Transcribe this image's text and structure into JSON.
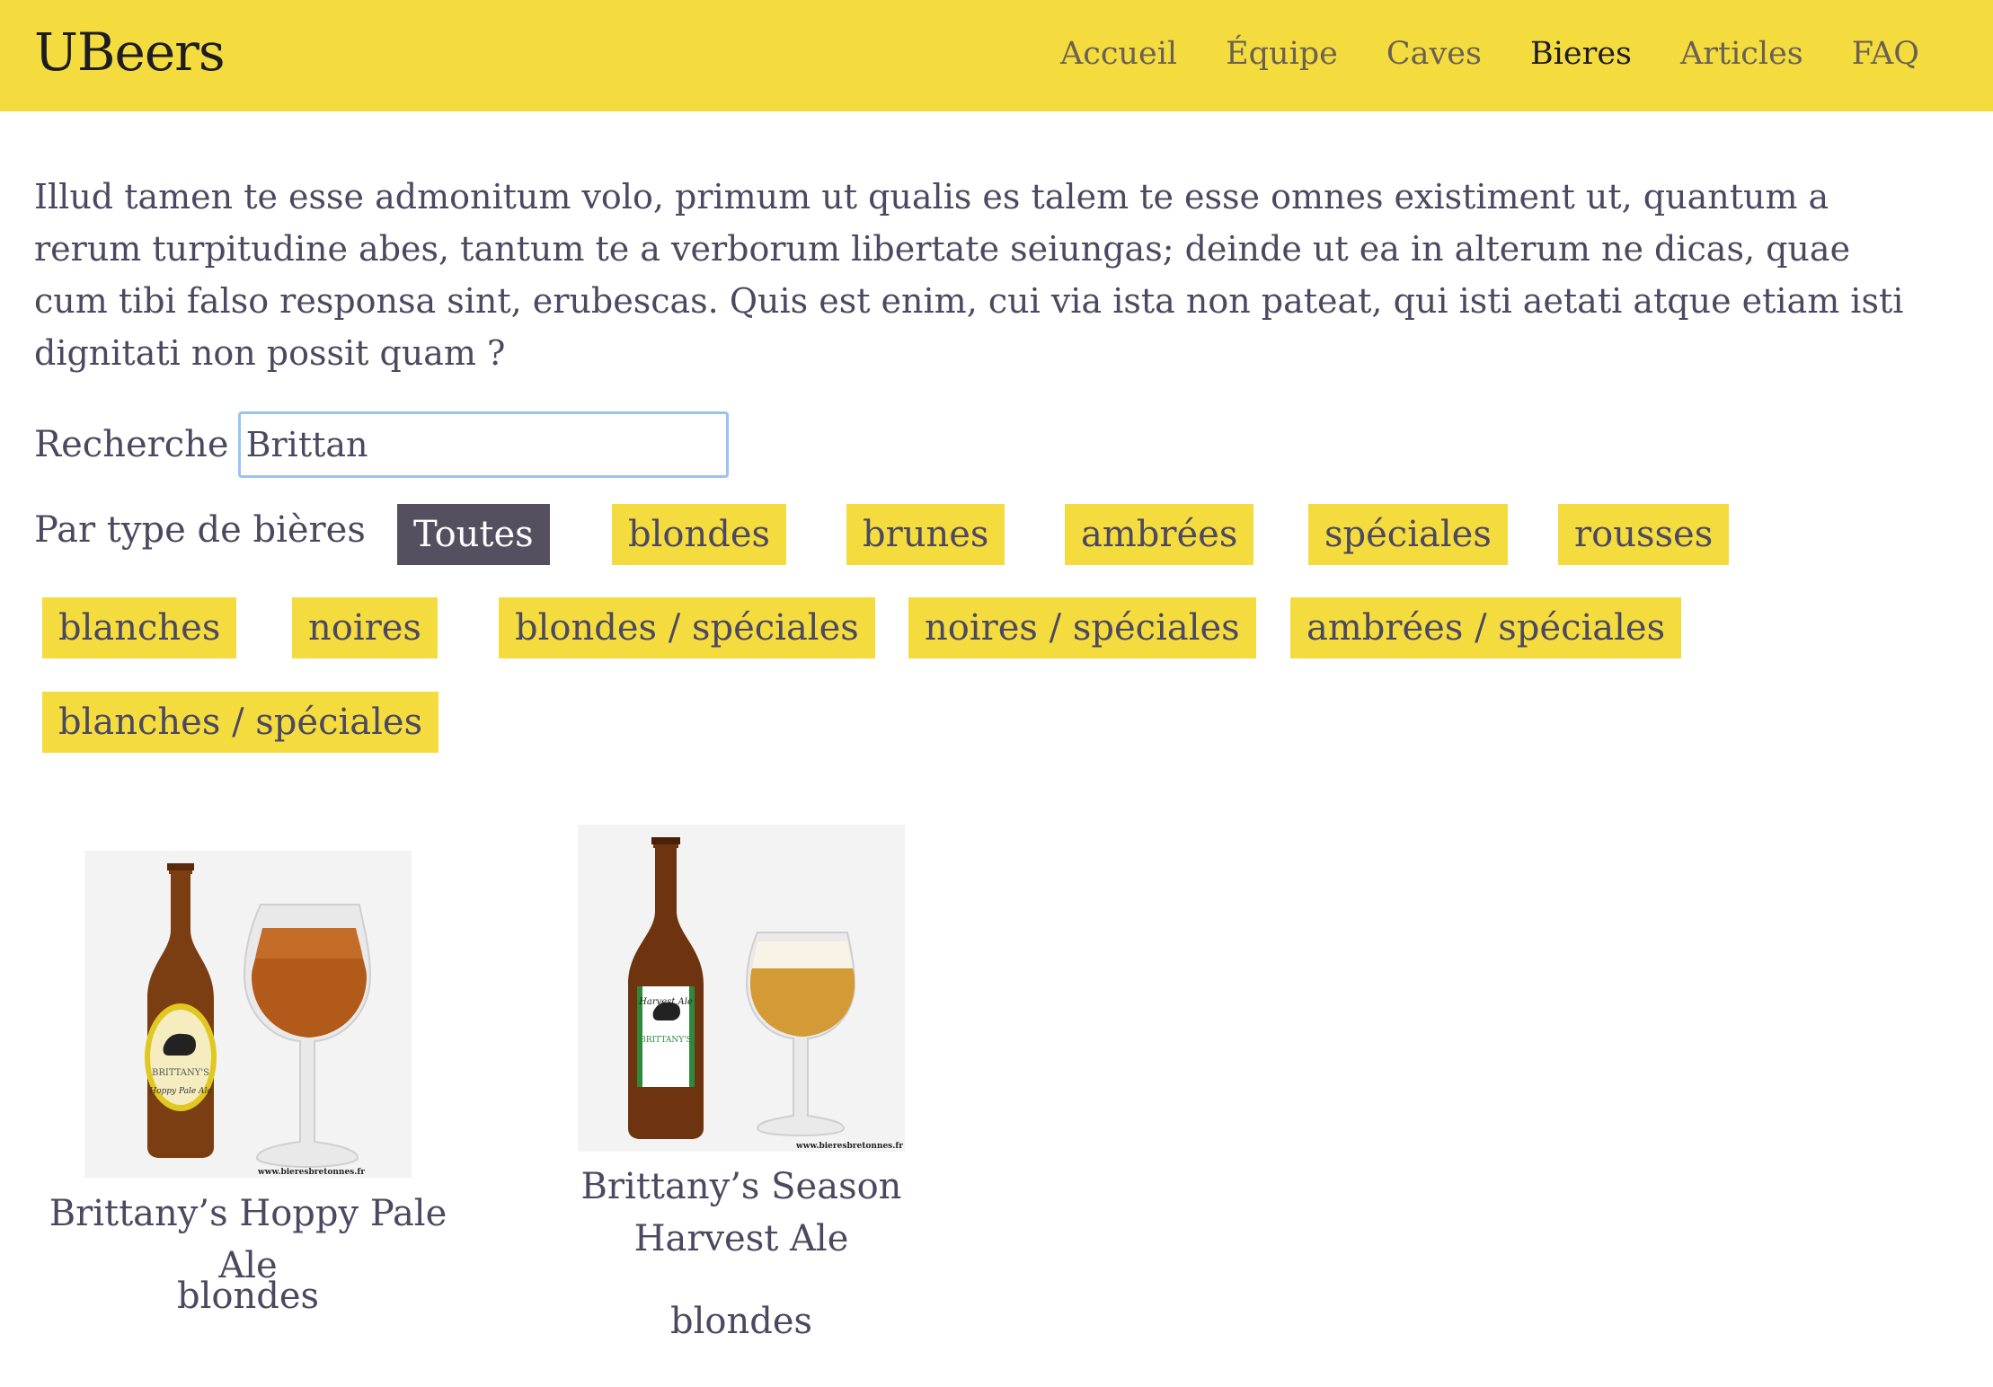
{
  "navbar": {
    "brand": "UBeers",
    "links": [
      "Accueil",
      "Équipe",
      "Caves",
      "Bieres",
      "Articles",
      "FAQ"
    ],
    "active": "Bieres"
  },
  "intro": {
    "text": "Illud tamen te esse admonitum volo, primum ut qualis es talem te esse omnes existiment ut, quantum a rerum turpitudine abes, tantum te a verborum libertate seiungas; deinde ut ea in alterum ne dicas, quae cum tibi falso responsa sint, erubescas. Quis est enim, cui via ista non pateat, qui isti aetati atque etiam isti dignitati non possit quam ?"
  },
  "search": {
    "label": "Recherche",
    "value": "Brittan"
  },
  "filters": {
    "label": "Par type de bières",
    "chips": [
      "Toutes",
      "blondes",
      "brunes",
      "ambrées",
      "spéciales",
      "rousses",
      "blanches",
      "noires",
      "blondes / spéciales",
      "noires / spéciales",
      "ambrées / spéciales",
      "blanches / spéciales"
    ],
    "active": "Toutes"
  },
  "products": [
    {
      "name": "Brittany’s Hoppy Pale Ale",
      "type": "blondes",
      "label_brand": "BRITTANY'S",
      "label_sub": "Hoppy Pale Ale",
      "watermark": "www.bieresbretonnes.fr"
    },
    {
      "name": "Brittany’s Season Harvest Ale",
      "type": "blondes",
      "label_brand": "BRITTANY'S",
      "label_sub": "Harvest Ale",
      "watermark": "www.bieresbretonnes.fr"
    }
  ],
  "colors": {
    "brand_yellow": "#f4dc3e",
    "active_chip": "#55505f",
    "text": "#4b4860"
  }
}
